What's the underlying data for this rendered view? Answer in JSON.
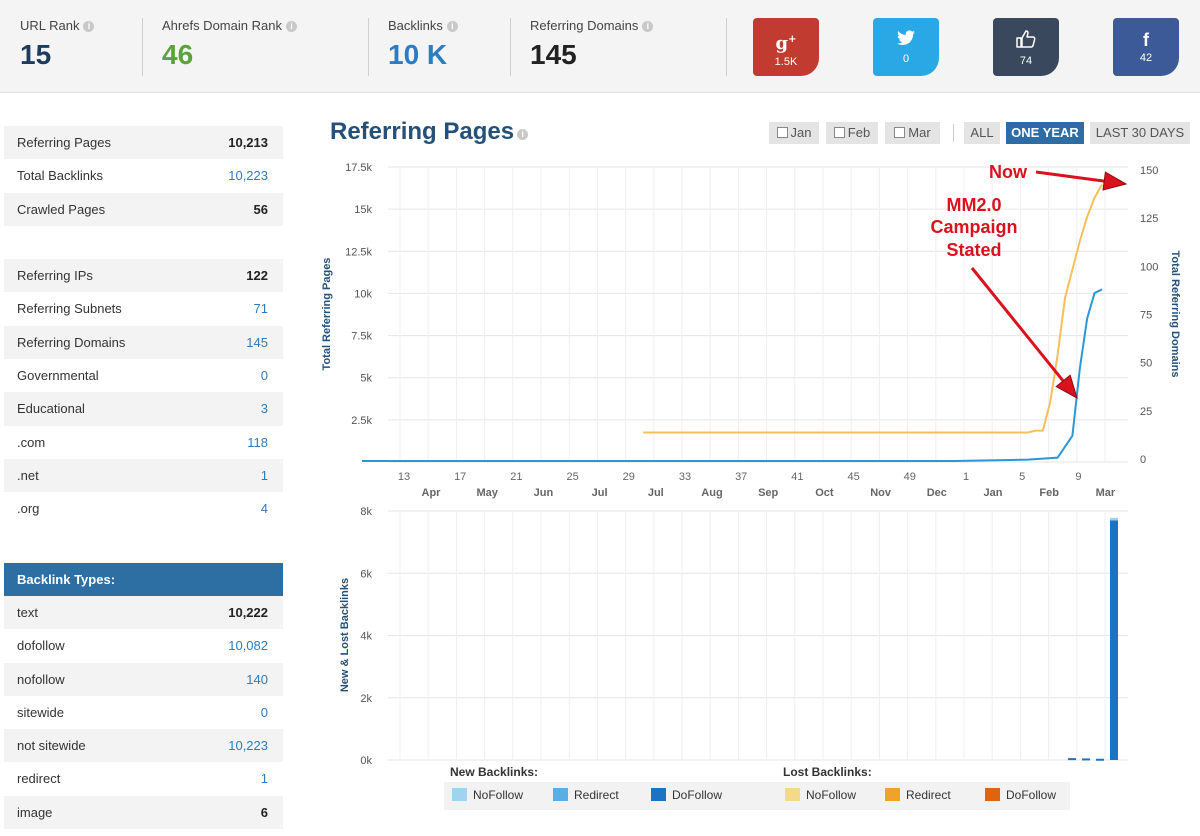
{
  "metrics": [
    {
      "label": "URL Rank",
      "value": "15",
      "color": "#1d3c5c"
    },
    {
      "label": "Ahrefs Domain Rank",
      "value": "46",
      "color": "#5aa33c"
    },
    {
      "label": "Backlinks",
      "value": "10 K",
      "color": "#2f7bbf"
    },
    {
      "label": "Referring Domains",
      "value": "145",
      "color": "#222222"
    }
  ],
  "social": [
    {
      "icon": "google-plus-icon",
      "glyph": "g+",
      "count": "1.5K",
      "color": "#c23b30"
    },
    {
      "icon": "twitter-icon",
      "glyph": "🐦",
      "count": "0",
      "color": "#2aa8e6"
    },
    {
      "icon": "thumbs-up-icon",
      "glyph": "👍",
      "count": "74",
      "color": "#39485c"
    },
    {
      "icon": "facebook-icon",
      "glyph": "f",
      "count": "42",
      "color": "#3b5a97"
    }
  ],
  "stats_top": [
    {
      "label": "Referring Pages",
      "value": "10,213",
      "style": "dark"
    },
    {
      "label": "Total Backlinks",
      "value": "10,223",
      "style": "blue"
    },
    {
      "label": "Crawled Pages",
      "value": "56",
      "style": "dark"
    },
    {
      "label": "",
      "value": "",
      "style": "dark"
    },
    {
      "label": "Referring IPs",
      "value": "122",
      "style": "dark"
    },
    {
      "label": "Referring Subnets",
      "value": "71",
      "style": "blue"
    },
    {
      "label": "Referring Domains",
      "value": "145",
      "style": "blue"
    },
    {
      "label": "Governmental",
      "value": "0",
      "style": "blue"
    },
    {
      "label": "Educational",
      "value": "3",
      "style": "blue"
    },
    {
      "label": ".com",
      "value": "118",
      "style": "blue"
    },
    {
      "label": ".net",
      "value": "1",
      "style": "blue"
    },
    {
      "label": ".org",
      "value": "4",
      "style": "blue"
    }
  ],
  "backlink_types": {
    "header": "Backlink Types:",
    "rows": [
      {
        "label": "text",
        "value": "10,222",
        "style": "dark"
      },
      {
        "label": "dofollow",
        "value": "10,082",
        "style": "blue"
      },
      {
        "label": "nofollow",
        "value": "140",
        "style": "blue"
      },
      {
        "label": "sitewide",
        "value": "0",
        "style": "blue"
      },
      {
        "label": "not sitewide",
        "value": "10,223",
        "style": "blue"
      },
      {
        "label": "redirect",
        "value": "1",
        "style": "blue"
      },
      {
        "label": "image",
        "value": "6",
        "style": "dark"
      }
    ]
  },
  "chart_title": "Referring Pages",
  "range_buttons": [
    {
      "label": "Jan",
      "checkbox": true
    },
    {
      "label": "Feb",
      "checkbox": true
    },
    {
      "label": "Mar",
      "checkbox": true
    },
    {
      "label": "ALL",
      "checkbox": false
    },
    {
      "label": "ONE YEAR",
      "checkbox": false,
      "active": true
    },
    {
      "label": "LAST 30 DAYS",
      "checkbox": false
    }
  ],
  "annotations": {
    "now": "Now",
    "campaign_line1": "MM2.0",
    "campaign_line2": "Campaign",
    "campaign_line3": "Stated"
  },
  "legend": {
    "new_title": "New Backlinks:",
    "lost_title": "Lost Backlinks:",
    "new_items": [
      {
        "label": "NoFollow",
        "color": "#9fd3f0"
      },
      {
        "label": "Redirect",
        "color": "#5aaee2"
      },
      {
        "label": "DoFollow",
        "color": "#1a73c4"
      }
    ],
    "lost_items": [
      {
        "label": "NoFollow",
        "color": "#f3d98c"
      },
      {
        "label": "Redirect",
        "color": "#f0a32a"
      },
      {
        "label": "DoFollow",
        "color": "#de6412"
      }
    ]
  },
  "chart_data": [
    {
      "type": "line",
      "title": "Referring Pages",
      "ylabel": "Total Referring Pages",
      "y2label": "Total Referring Domains",
      "ylim": [
        0,
        17500
      ],
      "y2lim": [
        0,
        150
      ],
      "y_ticks": [
        "2.5k",
        "5k",
        "7.5k",
        "10k",
        "12.5k",
        "15k",
        "17.5k"
      ],
      "y2_ticks": [
        "0",
        "25",
        "50",
        "75",
        "100",
        "125",
        "150"
      ],
      "x_week_ticks": [
        "13",
        "17",
        "21",
        "25",
        "29",
        "33",
        "37",
        "41",
        "45",
        "49",
        "1",
        "5",
        "9"
      ],
      "x_month_ticks": [
        "Apr",
        "May",
        "Jun",
        "Jul",
        "Jul",
        "Aug",
        "Sep",
        "Oct",
        "Nov",
        "Dec",
        "Jan",
        "Feb",
        "Mar"
      ],
      "series": [
        {
          "name": "Total Referring Pages",
          "axis": "left",
          "color": "#2b97d6",
          "x": [
            0,
            30,
            40,
            45,
            47,
            48,
            48.5,
            49,
            49.5,
            50
          ],
          "y": [
            0,
            0,
            0,
            80,
            200,
            1500,
            5500,
            8500,
            10000,
            10213
          ]
        },
        {
          "name": "Total Referring Domains",
          "axis": "right",
          "color": "#f5c05b",
          "x": [
            19,
            44,
            45,
            45.5,
            46,
            46.5,
            47,
            47.5,
            48,
            48.5,
            49,
            49.5,
            50
          ],
          "y": [
            14,
            14,
            14,
            15,
            15,
            30,
            55,
            85,
            100,
            115,
            128,
            138,
            145
          ]
        }
      ]
    },
    {
      "type": "bar",
      "ylabel": "New & Lost Backlinks",
      "ylim": [
        0,
        8000
      ],
      "y_ticks": [
        "0k",
        "2k",
        "4k",
        "6k",
        "8k"
      ],
      "series": [
        {
          "name": "New DoFollow",
          "color": "#1a73c4",
          "x": [
            47,
            48,
            49,
            50
          ],
          "values": [
            60,
            50,
            40,
            7700
          ]
        },
        {
          "name": "New NoFollow",
          "color": "#9fd3f0",
          "x": [
            50
          ],
          "values": [
            80
          ]
        }
      ]
    }
  ]
}
